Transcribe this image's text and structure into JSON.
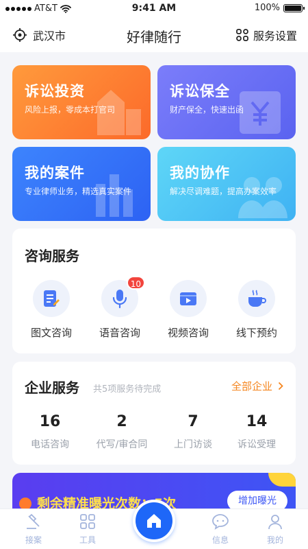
{
  "status": {
    "carrier": "AT&T",
    "time": "9:41 AM",
    "battery": "100%"
  },
  "nav": {
    "location": "武汉市",
    "title": "好律随行",
    "settings": "服务设置"
  },
  "features": [
    {
      "title": "诉讼投资",
      "subtitle": "风险上报，零成本打官司"
    },
    {
      "title": "诉讼保全",
      "subtitle": "财产保全，快速出函"
    },
    {
      "title": "我的案件",
      "subtitle": "专业律师业务，精选真实案件"
    },
    {
      "title": "我的协作",
      "subtitle": "解决尽调难题，提高办案效率"
    }
  ],
  "consult": {
    "title": "咨询服务",
    "items": [
      {
        "label": "图文咨询",
        "icon": "document-edit-icon"
      },
      {
        "label": "语音咨询",
        "icon": "microphone-icon",
        "badge": "10"
      },
      {
        "label": "视频咨询",
        "icon": "video-icon"
      },
      {
        "label": "线下预约",
        "icon": "coffee-cup-icon"
      }
    ]
  },
  "enterprise": {
    "title": "企业服务",
    "subtitle": "共5项服务待完成",
    "link": "全部企业",
    "stats": [
      {
        "value": "16",
        "label": "电话咨询"
      },
      {
        "value": "2",
        "label": "代写/审合同"
      },
      {
        "value": "7",
        "label": "上门访谈"
      },
      {
        "value": "14",
        "label": "诉讼受理"
      }
    ]
  },
  "banner": {
    "text": "剩余精准曝光次数：5次",
    "button": "增加曝光"
  },
  "tabs": [
    {
      "label": "接案",
      "icon": "gavel-icon"
    },
    {
      "label": "工具",
      "icon": "grid-icon"
    },
    {
      "label": "",
      "icon": "home-icon"
    },
    {
      "label": "信息",
      "icon": "chat-icon"
    },
    {
      "label": "我的",
      "icon": "user-icon"
    }
  ],
  "colors": {
    "primary": "#1e67f8",
    "accent": "#f5861f",
    "badge": "#f2453d"
  }
}
